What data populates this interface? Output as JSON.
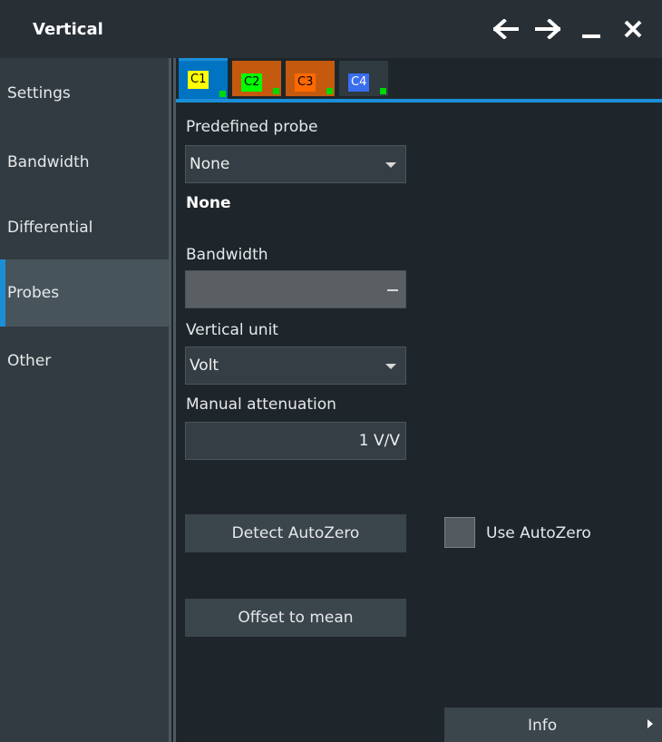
{
  "window": {
    "title": "Vertical"
  },
  "sidebar": {
    "items": [
      {
        "label": "Settings"
      },
      {
        "label": "Bandwidth"
      },
      {
        "label": "Differential"
      },
      {
        "label": "Probes"
      },
      {
        "label": "Other"
      }
    ],
    "active": "Probes"
  },
  "tabs": [
    {
      "label": "C1",
      "color": "#ffff00"
    },
    {
      "label": "C2",
      "color": "#00ff00"
    },
    {
      "label": "C3",
      "color": "#ff6a00"
    },
    {
      "label": "C4",
      "color": "#3a6df0"
    }
  ],
  "probe": {
    "predefined_label": "Predefined probe",
    "predefined_value": "None",
    "probe_name": "None",
    "bandwidth_label": "Bandwidth",
    "vertical_unit_label": "Vertical unit",
    "vertical_unit_value": "Volt",
    "attenuation_label": "Manual attenuation",
    "attenuation_value": "1 V/V",
    "detect_autozero_label": "Detect AutoZero",
    "use_autozero_label": "Use AutoZero",
    "use_autozero_checked": false,
    "offset_to_mean_label": "Offset to mean"
  },
  "footer": {
    "info_label": "Info"
  },
  "colors": {
    "accent": "#1a8fd8",
    "active_tab": "#0074c2",
    "inactive_tab": "#c55a0f"
  }
}
